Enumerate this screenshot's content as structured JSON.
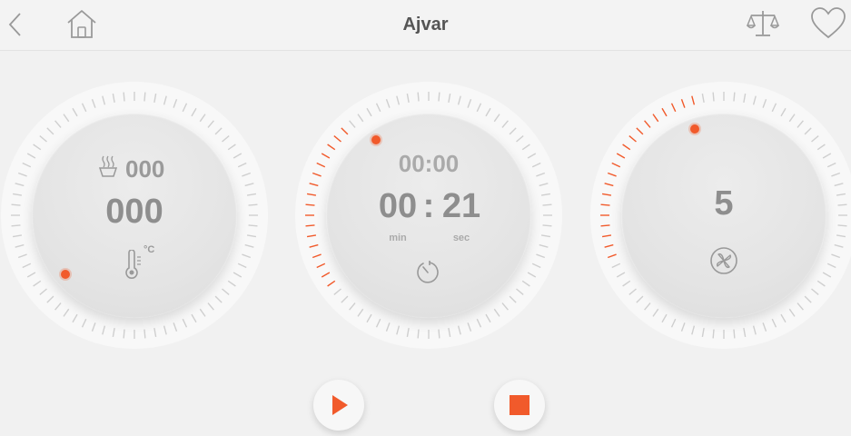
{
  "header": {
    "title": "Ajvar",
    "icons": [
      "back-chevron-icon",
      "home-icon",
      "scale-icon",
      "heart-icon"
    ]
  },
  "temperature": {
    "steam_value": "000",
    "value": "000",
    "unit": "°C",
    "icons": [
      "steam-icon",
      "thermometer-icon"
    ]
  },
  "timer": {
    "remaining": "00:00",
    "minutes": "00",
    "separator": ":",
    "seconds": "21",
    "min_label": "min",
    "sec_label": "sec",
    "icons": [
      "timer-icon"
    ]
  },
  "speed": {
    "value": "5",
    "icons": [
      "fan-icon"
    ]
  },
  "controls": {
    "play_icon": "play-icon",
    "stop_icon": "stop-icon"
  },
  "colors": {
    "accent": "#f15a2b",
    "tick": "#cfcfcf",
    "text": "#9a9a9a",
    "title": "#555555"
  }
}
